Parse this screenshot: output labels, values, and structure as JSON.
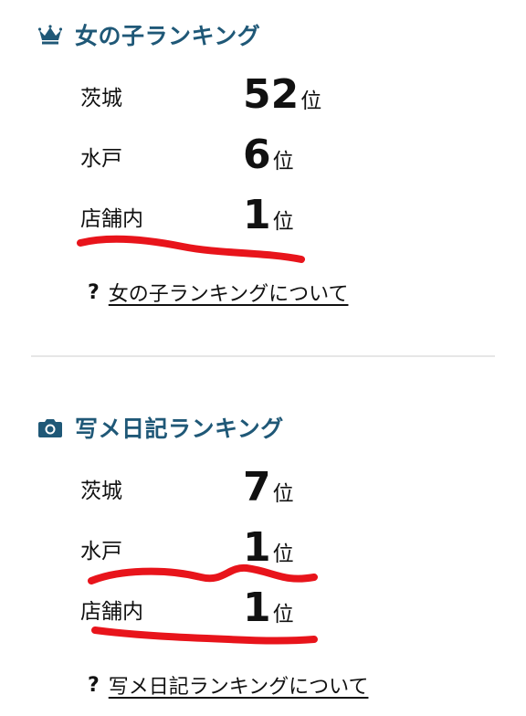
{
  "girls_ranking": {
    "title": "女の子ランキング",
    "icon": "crown-icon",
    "rows": [
      {
        "area": "茨城",
        "rank": "52",
        "unit": "位"
      },
      {
        "area": "水戸",
        "rank": "6",
        "unit": "位"
      },
      {
        "area": "店舗内",
        "rank": "1",
        "unit": "位"
      }
    ],
    "about_mark": "?",
    "about_link": "女の子ランキングについて"
  },
  "photo_diary_ranking": {
    "title": "写メ日記ランキング",
    "icon": "camera-icon",
    "rows": [
      {
        "area": "茨城",
        "rank": "7",
        "unit": "位"
      },
      {
        "area": "水戸",
        "rank": "1",
        "unit": "位"
      },
      {
        "area": "店舗内",
        "rank": "1",
        "unit": "位"
      }
    ],
    "about_mark": "?",
    "about_link": "写メ日記ランキングについて"
  },
  "colors": {
    "heading": "#1f5877",
    "scribble": "#e8141b"
  }
}
